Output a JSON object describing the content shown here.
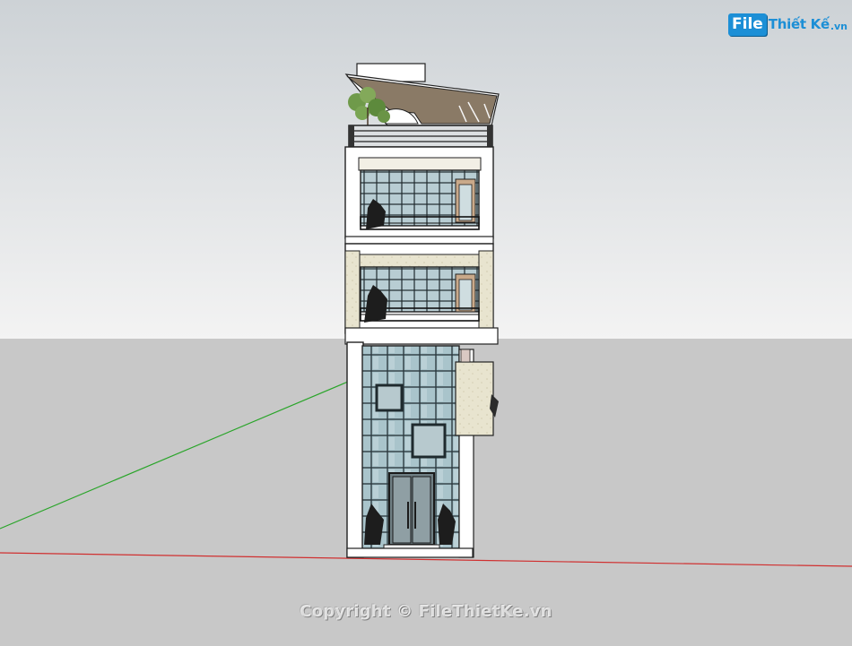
{
  "logo": {
    "badge": "File",
    "name": "Thiết Kế",
    "tld": ".vn"
  },
  "watermark": {
    "text": "Copyright © FileThietKe.vn"
  },
  "colors": {
    "sky_top": "#cdd2d6",
    "sky_bottom": "#f2f2f2",
    "ground": "#c8c8c8",
    "red_axis": "#d03030",
    "green_axis": "#2aa52a",
    "glass": "#9fbcc4",
    "wall": "#ffffff",
    "stone": "#e6e2cc",
    "brand": "#1c8fd6"
  }
}
